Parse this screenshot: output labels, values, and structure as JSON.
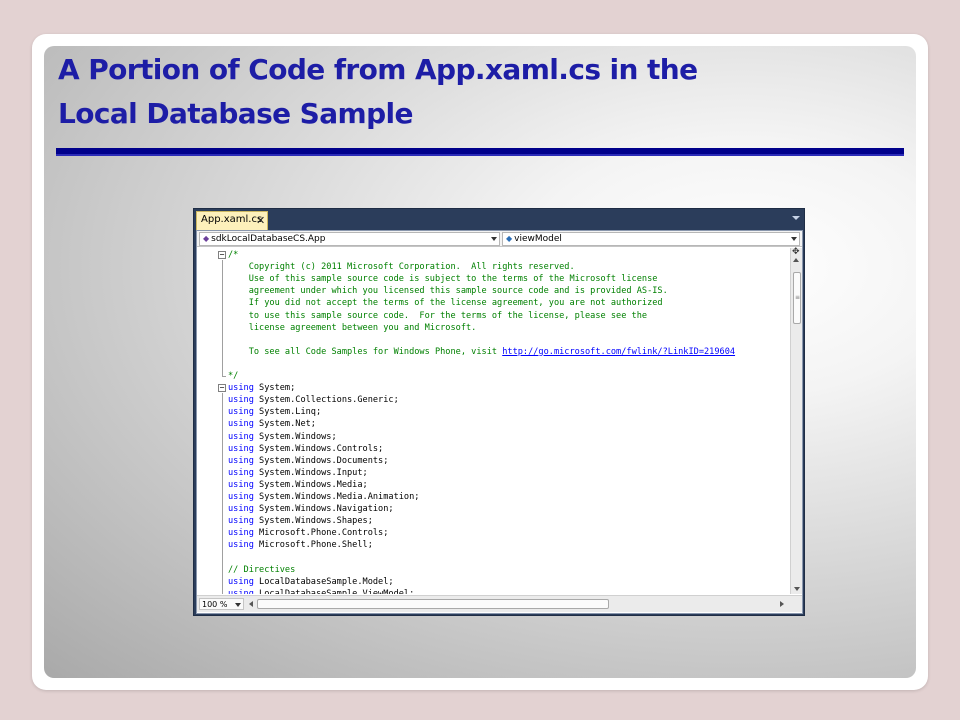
{
  "slide": {
    "title_line1": "A Portion of Code from App.xaml.cs in the",
    "title_line2": "Local Database Sample"
  },
  "ide": {
    "tab_label": "App.xaml.cs",
    "tab_close": "✕",
    "nav_class": "sdkLocalDatabaseCS.App",
    "nav_member": "viewModel",
    "zoom": "100 %",
    "splitter_glyph": "✥"
  },
  "colors": {
    "title": "#1d1da6",
    "rule": "#00008b",
    "keyword": "#0000ff",
    "comment": "#008000",
    "tab_active": "#fdf0bb"
  },
  "code": {
    "comment_lines": [
      "/*",
      "    Copyright (c) 2011 Microsoft Corporation.  All rights reserved.",
      "    Use of this sample source code is subject to the terms of the Microsoft license",
      "    agreement under which you licensed this sample source code and is provided AS-IS.",
      "    If you did not accept the terms of the license agreement, you are not authorized",
      "    to use this sample source code.  For the terms of the license, please see the",
      "    license agreement between you and Microsoft.",
      "",
      "    To see all Code Samples for Windows Phone, visit ",
      "",
      "*/"
    ],
    "link": "http://go.microsoft.com/fwlink/?LinkID=219604",
    "using_keyword": "using",
    "usings": [
      " System;",
      " System.Collections.Generic;",
      " System.Linq;",
      " System.Net;",
      " System.Windows;",
      " System.Windows.Controls;",
      " System.Windows.Documents;",
      " System.Windows.Input;",
      " System.Windows.Media;",
      " System.Windows.Media.Animation;",
      " System.Windows.Navigation;",
      " System.Windows.Shapes;",
      " Microsoft.Phone.Controls;",
      " Microsoft.Phone.Shell;"
    ],
    "directives_comment": "// Directives",
    "directive_usings": [
      " LocalDatabaseSample.Model;",
      " LocalDatabaseSample.ViewModel;"
    ]
  }
}
